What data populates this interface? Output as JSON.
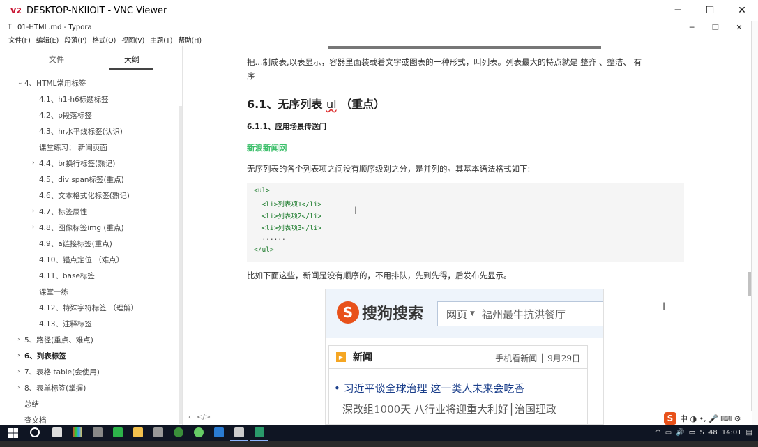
{
  "vnc": {
    "logo": "V2",
    "title": "DESKTOP-NKIIOIT - VNC Viewer",
    "buttons": {
      "minimize": "─",
      "maximize": "☐",
      "close": "✕"
    }
  },
  "typora": {
    "title": "01-HTML.md - Typora",
    "buttons": {
      "minimize": "─",
      "restore": "❐",
      "close": "✕"
    }
  },
  "menu": [
    "文件(F)",
    "编辑(E)",
    "段落(P)",
    "格式(O)",
    "视图(V)",
    "主题(T)",
    "帮助(H)"
  ],
  "sidebar": {
    "tab_file": "文件",
    "tab_outline": "大纲",
    "items": [
      {
        "label": "4、HTML常用标签",
        "arrow": "⌄",
        "bold": false
      },
      {
        "label": "4.1、h1-h6标题标签",
        "arrow": "",
        "bold": false
      },
      {
        "label": "4.2、p段落标签",
        "arrow": "",
        "bold": false
      },
      {
        "label": "4.3、hr水平线标签(认识)",
        "arrow": "",
        "bold": false
      },
      {
        "label": "课堂练习： 新闻页面",
        "arrow": "",
        "bold": false
      },
      {
        "label": "4.4、br换行标签(熟记)",
        "arrow": "›",
        "bold": false
      },
      {
        "label": "4.5、div span标签(重点)",
        "arrow": "",
        "bold": false
      },
      {
        "label": "4.6、文本格式化标签(熟记)",
        "arrow": "",
        "bold": false
      },
      {
        "label": "4.7、标签属性",
        "arrow": "›",
        "bold": false
      },
      {
        "label": "4.8、图像标签img (重点)",
        "arrow": "›",
        "bold": false
      },
      {
        "label": "4.9、a链接标签(重点)",
        "arrow": "",
        "bold": false
      },
      {
        "label": "4.10、锚点定位 （难点）",
        "arrow": "",
        "bold": false
      },
      {
        "label": "4.11、base标签",
        "arrow": "",
        "bold": false
      },
      {
        "label": "课堂一练",
        "arrow": "",
        "bold": false
      },
      {
        "label": "4.12、特殊字符标签 （理解）",
        "arrow": "",
        "bold": false
      },
      {
        "label": "4.13、注释标签",
        "arrow": "",
        "bold": false
      },
      {
        "label": "5、路径(重点、难点)",
        "arrow": "›",
        "bold": false
      },
      {
        "label": "6、列表标签",
        "arrow": "›",
        "bold": true
      },
      {
        "label": "7、表格 table(会使用)",
        "arrow": "›",
        "bold": false
      },
      {
        "label": "8、表单标签(掌握)",
        "arrow": "›",
        "bold": false
      },
      {
        "label": "总结",
        "arrow": "",
        "bold": false
      },
      {
        "label": "查文档",
        "arrow": "",
        "bold": false
      }
    ]
  },
  "editor": {
    "para1_line1": "把...制成表,以表显示，容器里面装载着文字或图表的一种形式，叫列表。列表最大的特点就是 整齐 、整洁、 有",
    "para1_line2": "序",
    "h2_prefix": "6.1、无序列表",
    "h2_ul": "ul",
    "h2_suffix": "（重点）",
    "h4": "6.1.1、应用场景传送门",
    "link": "新浪新闻网",
    "para2": "无序列表的各个列表项之间没有顺序级别之分，是并列的。其基本语法格式如下:",
    "code": {
      "l1": "<ul>",
      "l2": "  <li>列表项1</li>",
      "l3": "  <li>列表项2</li>",
      "l4": "  <li>列表项3</li>",
      "l5": "  ......",
      "l6": "</ul>"
    },
    "para3": "比如下面这些，新闻是没有顺序的，不用排队，先到先得，后发布先显示。",
    "footer_left": "‹",
    "footer_code": "</>"
  },
  "sogou": {
    "logo_s": "S",
    "logo_text": "搜狗搜索",
    "category": "网页",
    "query": "福州最牛抗洪餐厅",
    "news_title": "新闻",
    "news_right": "手机看新闻 │ 9月29日",
    "item1": "• 习近平谈全球治理 这一类人未来会吃香",
    "item2": "深改组1000天 八行业将迎重大利好│治国理政"
  },
  "ime": {
    "s": "S",
    "glyphs": "中 ◑ •, 🎤 ⌨ ⚙"
  },
  "taskbar": {
    "tray_items": [
      "^",
      "▭",
      "🔊",
      "中",
      "S",
      "48",
      "14:01",
      "▤"
    ],
    "colors": {
      "bg": "#0f1523",
      "accent": "#8cb4ff"
    }
  }
}
